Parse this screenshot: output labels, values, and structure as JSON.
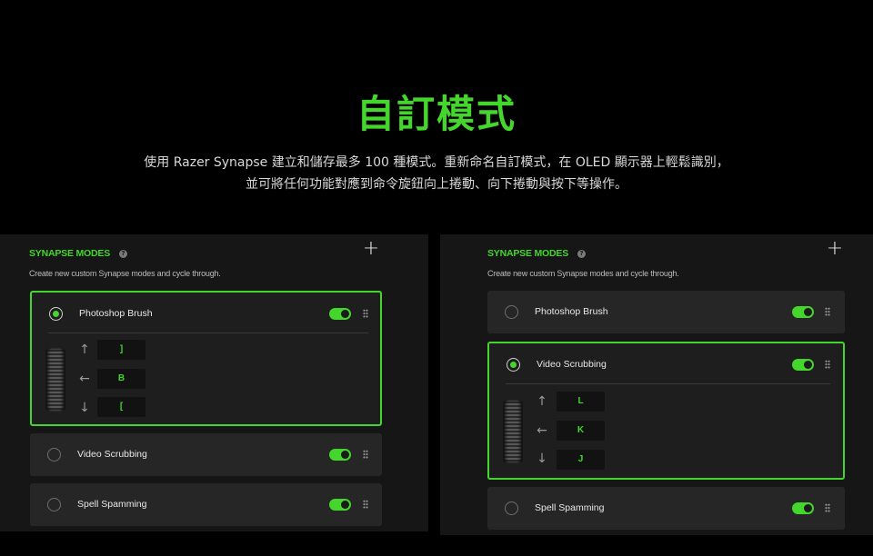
{
  "hero": {
    "title": "自訂模式",
    "desc_line1": "使用 Razer Synapse 建立和儲存最多 100 種模式。重新命名自訂模式，在 OLED 顯示器上輕鬆識別，",
    "desc_line2": "並可將任何功能對應到命令旋鈕向上捲動、向下捲動與按下等操作。"
  },
  "panels": [
    {
      "title": "SYNAPSE MODES",
      "help_icon": "?",
      "add_icon": "+",
      "subtitle": "Create new custom Synapse modes and cycle through.",
      "modes": [
        {
          "name": "Photoshop Brush",
          "selected": true,
          "enabled": true,
          "bindings": {
            "up": "]",
            "left": "B",
            "down": "["
          }
        },
        {
          "name": "Video Scrubbing",
          "selected": false,
          "enabled": true
        },
        {
          "name": "Spell Spamming",
          "selected": false,
          "enabled": true
        }
      ]
    },
    {
      "title": "SYNAPSE MODES",
      "help_icon": "?",
      "add_icon": "+",
      "subtitle": "Create new custom Synapse modes and cycle through.",
      "modes": [
        {
          "name": "Photoshop Brush",
          "selected": false,
          "enabled": true
        },
        {
          "name": "Video Scrubbing",
          "selected": true,
          "enabled": true,
          "bindings": {
            "up": "L",
            "left": "K",
            "down": "J"
          }
        },
        {
          "name": "Spell Spamming",
          "selected": false,
          "enabled": true
        }
      ]
    }
  ],
  "icons": {
    "up": "↑",
    "left": "←",
    "down": "↓"
  },
  "colors": {
    "accent": "#44d62c",
    "background": "#000000",
    "panel": "#161616",
    "card": "#262626"
  }
}
